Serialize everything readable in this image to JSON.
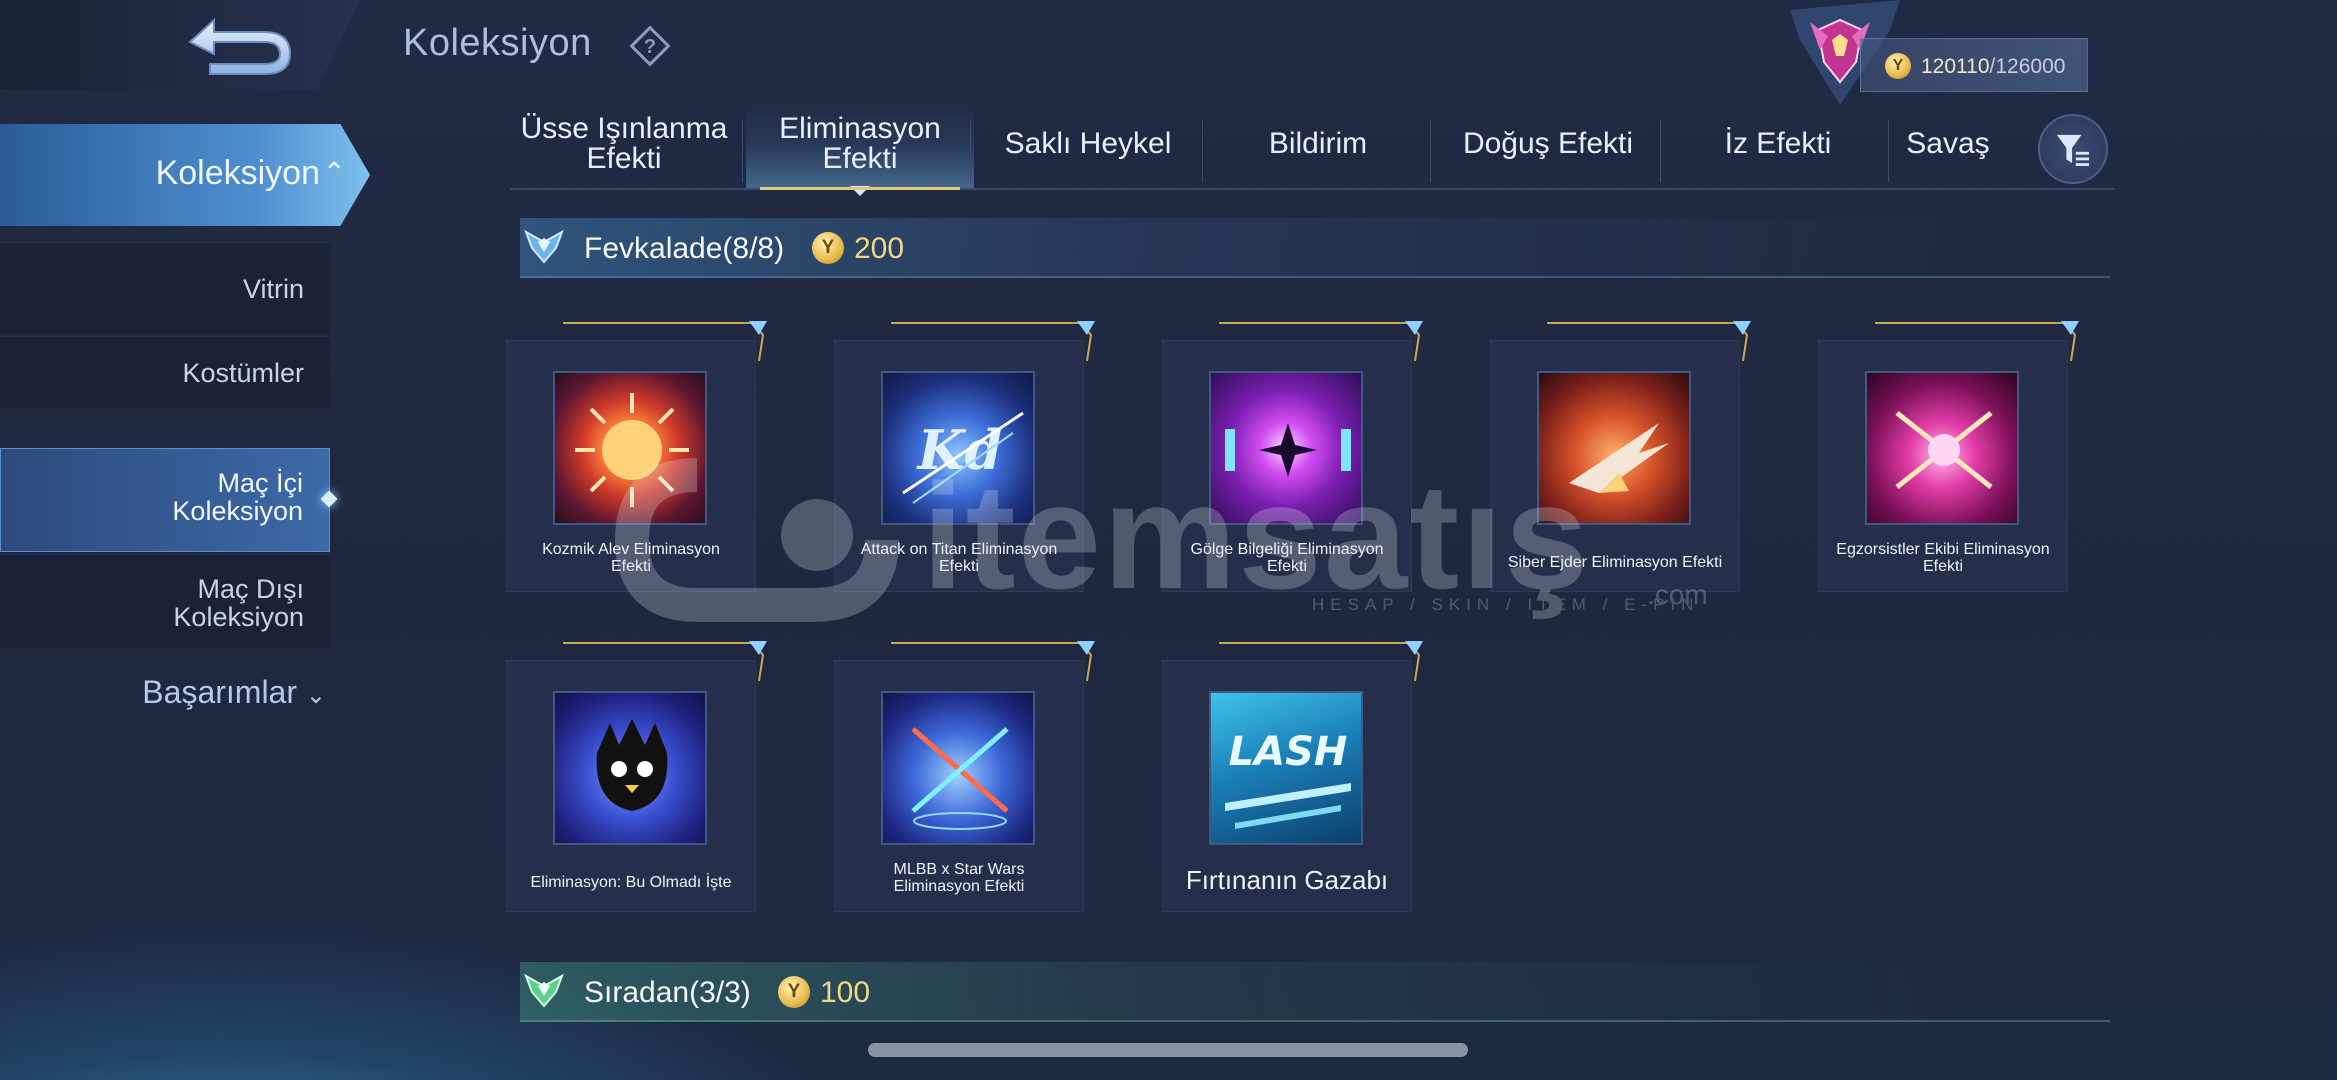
{
  "header": {
    "title": "Koleksiyon",
    "points_current": "120110",
    "points_max": "/126000",
    "coin_glyph": "Y"
  },
  "sidebar": {
    "main_label": "Koleksiyon",
    "items": [
      {
        "label": "Vitrin"
      },
      {
        "label": "Kostümler"
      },
      {
        "label": "Maç İçi\nKoleksiyon"
      },
      {
        "label": "Maç Dışı\nKoleksiyon"
      }
    ],
    "bottom_label": "Başarımlar"
  },
  "tabs": [
    {
      "label": "Üsse Işınlanma\nEfekti"
    },
    {
      "label": "Eliminasyon\nEfekti"
    },
    {
      "label": "Saklı Heykel"
    },
    {
      "label": "Bildirim"
    },
    {
      "label": "Doğuş Efekti"
    },
    {
      "label": "İz Efekti"
    },
    {
      "label": "Savaş"
    }
  ],
  "sections": [
    {
      "name": "Fevkalade(8/8)",
      "cost": "200"
    },
    {
      "name": "Sıradan(3/3)",
      "cost": "100"
    }
  ],
  "cards": [
    {
      "caption": "Kozmik Alev Eliminasyon\nEfekti"
    },
    {
      "caption": "Attack on Titan Eliminasyon\nEfekti"
    },
    {
      "caption": "Gölge Bilgeliği Eliminasyon\nEfekti"
    },
    {
      "caption": "Siber Ejder Eliminasyon Efekti"
    },
    {
      "caption": "Egzorsistler Ekibi Eliminasyon\nEfekti"
    },
    {
      "caption": "Eliminasyon: Bu Olmadı İşte"
    },
    {
      "caption": "MLBB x Star Wars\nEliminasyon Efekti"
    },
    {
      "caption": "Fırtınanın Gazabı"
    }
  ],
  "watermark": {
    "text": "itemsatış",
    "sub": "HESAP / SKIN / ITEM / E-PIN",
    "com": ".com"
  },
  "colors": {
    "accent_blue": "#4f8fd0",
    "gold": "#f3d784",
    "background": "#212a44"
  },
  "icons": [
    "back-arrow-icon",
    "help-icon",
    "rank-emblem-icon",
    "coin-icon",
    "filter-icon",
    "chevron-up-icon",
    "chevron-down-icon"
  ]
}
